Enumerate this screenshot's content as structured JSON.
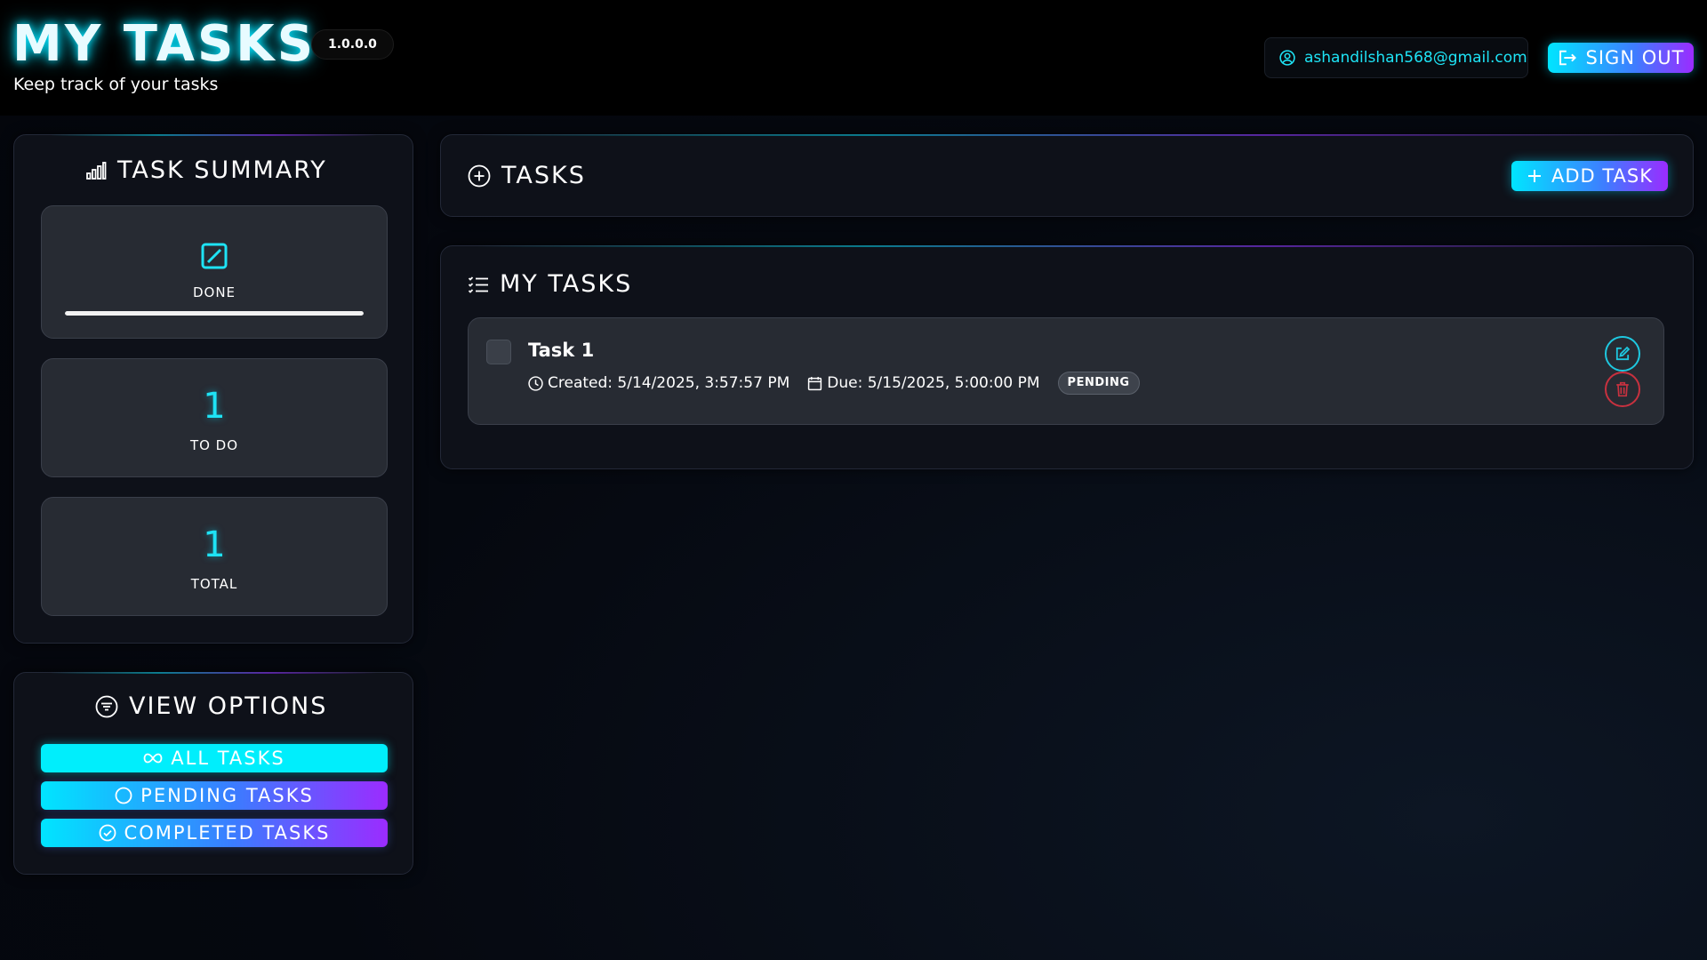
{
  "header": {
    "title": "MY TASKS",
    "version": "1.0.0.0",
    "subtitle": "Keep track of your tasks",
    "user_email": "ashandilshan568@gmail.com",
    "sign_out_label": "SIGN OUT"
  },
  "summary": {
    "title": "TASK SUMMARY",
    "done_label": "DONE",
    "done_progress": 1.0,
    "todo_value": "1",
    "todo_label": "TO DO",
    "total_value": "1",
    "total_label": "TOTAL"
  },
  "view_options": {
    "title": "VIEW OPTIONS",
    "all_label": "ALL TASKS",
    "pending_label": "PENDING TASKS",
    "completed_label": "COMPLETED TASKS"
  },
  "tasks_header": {
    "title": "TASKS",
    "add_label": "ADD TASK"
  },
  "my_tasks": {
    "title": "MY TASKS",
    "items": [
      {
        "title": "Task 1",
        "created": "Created: 5/14/2025, 3:57:57 PM",
        "due": "Due: 5/15/2025, 5:00:00 PM",
        "status": "PENDING",
        "checked": false
      }
    ]
  },
  "colors": {
    "accent_cyan": "#00e5ff",
    "accent_purple": "#9b2cff",
    "danger": "#c8313f",
    "background": "#05080f"
  },
  "icons": {
    "header_user": "user-circle-icon",
    "signout": "box-arrow-right-icon",
    "summary": "bar-chart-icon",
    "done": "slash-square-icon",
    "view_options": "filter-circle-icon",
    "all": "infinity-icon",
    "pending": "circle-icon",
    "completed": "check-circle-icon",
    "tasks": "plus-circle-icon",
    "add": "plus-icon",
    "my_tasks": "list-check-icon",
    "created": "clock-icon",
    "due": "calendar-icon",
    "edit": "pencil-square-icon",
    "delete": "trash-icon"
  }
}
